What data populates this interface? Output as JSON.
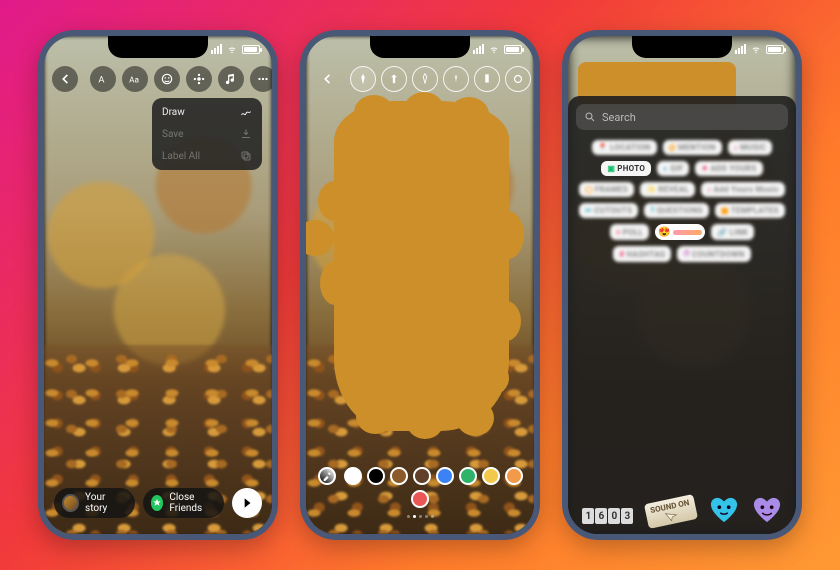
{
  "phone1": {
    "toolbar": {
      "back": "‹",
      "icons": [
        "text-icon",
        "font-icon",
        "sticker-icon",
        "effects-icon",
        "music-icon",
        "more-icon"
      ]
    },
    "menu": {
      "draw": "Draw",
      "save": "Save",
      "labelAll": "Label All"
    },
    "bottom": {
      "yourStory": "Your story",
      "closeFriends": "Close Friends"
    }
  },
  "phone2": {
    "toolbar_icons": [
      "brush-icon",
      "arrow-icon",
      "tool3-icon",
      "tool4-icon",
      "tool5-icon",
      "eraser-icon"
    ],
    "colors": [
      "#ffffff",
      "#000000",
      "#3a82f6",
      "#2fb36a",
      "#f2c94c",
      "#f2994a",
      "#eb5757",
      "#9b51e0"
    ],
    "selected_color": "#cc8f2a",
    "pagination": {
      "pages": 5,
      "current": 2
    }
  },
  "phone3": {
    "search_placeholder": "Search",
    "stickers": [
      {
        "label": "LOCATION",
        "icon": "📍",
        "c": "#e74"
      },
      {
        "label": "MENTION",
        "icon": "@",
        "c": "#f90"
      },
      {
        "label": "MUSIC",
        "icon": "♪",
        "c": "#e36"
      },
      {
        "label": "PHOTO",
        "icon": "▣",
        "c": "#1bbf6e",
        "clear": true
      },
      {
        "label": "GIF",
        "icon": "◐",
        "c": "#18a0c9"
      },
      {
        "label": "ADD YOURS",
        "icon": "✦",
        "c": "#e36"
      },
      {
        "label": "FRAMES",
        "icon": "▢",
        "c": "#f90"
      },
      {
        "label": "REVEAL",
        "icon": "✨",
        "c": "#7b5"
      },
      {
        "label": "Add Yours Music",
        "icon": "♪",
        "c": "#e36"
      },
      {
        "label": "CUTOUTS",
        "icon": "✂",
        "c": "#3ac"
      },
      {
        "label": "QUESTIONS",
        "icon": "?",
        "c": "#3ac"
      },
      {
        "label": "TEMPLATES",
        "icon": "▦",
        "c": "#f90"
      },
      {
        "label": "POLL",
        "icon": "≡",
        "c": "#e36"
      },
      {
        "label": "",
        "icon": "",
        "slider": true
      },
      {
        "label": "LINK",
        "icon": "🔗",
        "c": "#3ac"
      },
      {
        "label": "HASHTAG",
        "icon": "#",
        "c": "#e36"
      },
      {
        "label": "COUNTDOWN",
        "icon": "⏱",
        "c": "#c6c"
      }
    ],
    "bottom": {
      "time": [
        "1",
        "6",
        "0",
        "3"
      ],
      "sound": "SOUND ON"
    }
  }
}
